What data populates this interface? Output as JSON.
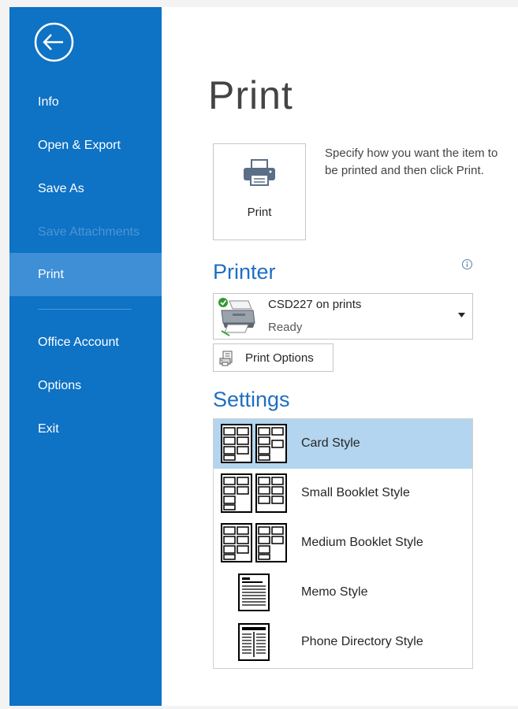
{
  "sidebar": {
    "back_label": "Back",
    "items": [
      {
        "label": "Info"
      },
      {
        "label": "Open & Export"
      },
      {
        "label": "Save As"
      },
      {
        "label": "Save Attachments"
      },
      {
        "label": "Print"
      },
      {
        "label": "Office Account"
      },
      {
        "label": "Options"
      },
      {
        "label": "Exit"
      }
    ],
    "active_item": "Print",
    "disabled_item": "Save Attachments"
  },
  "main": {
    "title": "Print",
    "print_button": {
      "label": "Print",
      "icon": "printer-icon"
    },
    "description": "Specify how you want the item to be printed and then click Print.",
    "printer": {
      "heading": "Printer",
      "name": "CSD227 on prints",
      "status": "Ready",
      "status_icon": "green-check-icon"
    },
    "print_options_label": "Print Options",
    "settings": {
      "heading": "Settings",
      "styles": [
        {
          "label": "Card Style",
          "icon": "card-style-icon"
        },
        {
          "label": "Small Booklet Style",
          "icon": "small-booklet-style-icon"
        },
        {
          "label": "Medium Booklet Style",
          "icon": "medium-booklet-style-icon"
        },
        {
          "label": "Memo Style",
          "icon": "memo-style-icon"
        },
        {
          "label": "Phone Directory Style",
          "icon": "phone-directory-style-icon"
        }
      ],
      "selected_style": "Card Style"
    }
  },
  "colors": {
    "sidebar_bg": "#0e72c5",
    "sidebar_active": "#3f8fd6",
    "heading_blue": "#1f6fc0",
    "selected_row": "#b3d5ef"
  }
}
